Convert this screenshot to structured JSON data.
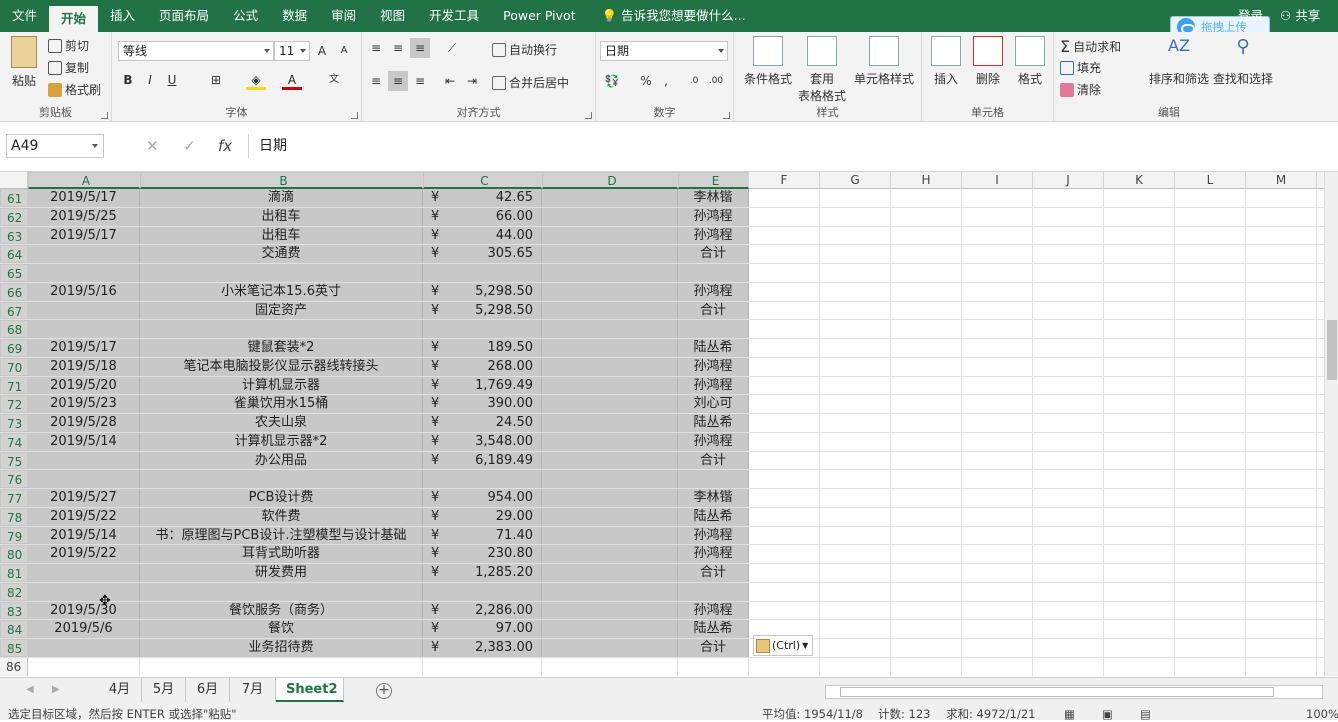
{
  "ribbon_tabs": [
    "文件",
    "开始",
    "插入",
    "页面布局",
    "公式",
    "数据",
    "审阅",
    "视图",
    "开发工具",
    "Power Pivot"
  ],
  "active_tab_index": 1,
  "tell_me": "告诉我您想要做什么...",
  "signin": "登录",
  "share": "共享",
  "baidu_upload": "拖拽上传",
  "clipboard": {
    "paste": "粘贴",
    "cut": "剪切",
    "copy": "复制",
    "format_painter": "格式刷",
    "label": "剪贴板"
  },
  "font": {
    "name": "等线",
    "size": "11",
    "label": "字体",
    "bold": "B",
    "italic": "I",
    "underline": "U"
  },
  "alignment": {
    "wrap": "自动换行",
    "merge": "合并后居中",
    "label": "对齐方式"
  },
  "number": {
    "format": "日期",
    "label": "数字"
  },
  "styles": {
    "cond": "条件格式",
    "table": "套用",
    "table2": "表格格式",
    "cell": "单元格样式",
    "label": "样式"
  },
  "cells": {
    "insert": "插入",
    "delete": "删除",
    "format": "格式",
    "label": "单元格"
  },
  "editing": {
    "autosum": "自动求和",
    "fill": "填充",
    "clear": "清除",
    "sort": "排序和筛选",
    "find": "查找和选择",
    "label": "编辑"
  },
  "namebox": "A49",
  "formula": "日期",
  "columns": [
    "A",
    "B",
    "C",
    "D",
    "E",
    "F",
    "G",
    "H",
    "I",
    "J",
    "K",
    "L",
    "M"
  ],
  "rows": [
    {
      "n": "61",
      "a": "2019/5/17",
      "b": "滴滴",
      "y": "¥",
      "c": "42.65",
      "e": "李林锴"
    },
    {
      "n": "62",
      "a": "2019/5/25",
      "b": "出租车",
      "y": "¥",
      "c": "66.00",
      "e": "孙鸿程"
    },
    {
      "n": "63",
      "a": "2019/5/17",
      "b": "出租车",
      "y": "¥",
      "c": "44.00",
      "e": "孙鸿程"
    },
    {
      "n": "64",
      "a": "",
      "b": "交通费",
      "y": "¥",
      "c": "305.65",
      "e": "合计"
    },
    {
      "n": "65",
      "a": "",
      "b": "",
      "y": "",
      "c": "",
      "e": ""
    },
    {
      "n": "66",
      "a": "2019/5/16",
      "b": "小米笔记本15.6英寸",
      "y": "¥",
      "c": "5,298.50",
      "e": "孙鸿程"
    },
    {
      "n": "67",
      "a": "",
      "b": "固定资产",
      "y": "¥",
      "c": "5,298.50",
      "e": "合计"
    },
    {
      "n": "68",
      "a": "",
      "b": "",
      "y": "",
      "c": "",
      "e": ""
    },
    {
      "n": "69",
      "a": "2019/5/17",
      "b": "键鼠套装*2",
      "y": "¥",
      "c": "189.50",
      "e": "陆丛希"
    },
    {
      "n": "70",
      "a": "2019/5/18",
      "b": "笔记本电脑投影仪显示器线转接头",
      "y": "¥",
      "c": "268.00",
      "e": "孙鸿程"
    },
    {
      "n": "71",
      "a": "2019/5/20",
      "b": "计算机显示器",
      "y": "¥",
      "c": "1,769.49",
      "e": "孙鸿程"
    },
    {
      "n": "72",
      "a": "2019/5/23",
      "b": "雀巢饮用水15桶",
      "y": "¥",
      "c": "390.00",
      "e": "刘心可"
    },
    {
      "n": "73",
      "a": "2019/5/28",
      "b": "农夫山泉",
      "y": "¥",
      "c": "24.50",
      "e": "陆丛希"
    },
    {
      "n": "74",
      "a": "2019/5/14",
      "b": "计算机显示器*2",
      "y": "¥",
      "c": "3,548.00",
      "e": "孙鸿程"
    },
    {
      "n": "75",
      "a": "",
      "b": "办公用品",
      "y": "¥",
      "c": "6,189.49",
      "e": "合计"
    },
    {
      "n": "76",
      "a": "",
      "b": "",
      "y": "",
      "c": "",
      "e": ""
    },
    {
      "n": "77",
      "a": "2019/5/27",
      "b": "PCB设计费",
      "y": "¥",
      "c": "954.00",
      "e": "李林锴"
    },
    {
      "n": "78",
      "a": "2019/5/22",
      "b": "软件费",
      "y": "¥",
      "c": "29.00",
      "e": "陆丛希"
    },
    {
      "n": "79",
      "a": "2019/5/14",
      "b": "书：原理图与PCB设计.注塑模型与设计基础",
      "y": "¥",
      "c": "71.40",
      "e": "孙鸿程"
    },
    {
      "n": "80",
      "a": "2019/5/22",
      "b": "耳背式助听器",
      "y": "¥",
      "c": "230.80",
      "e": "孙鸿程"
    },
    {
      "n": "81",
      "a": "",
      "b": "研发费用",
      "y": "¥",
      "c": "1,285.20",
      "e": "合计"
    },
    {
      "n": "82",
      "a": "",
      "b": "",
      "y": "",
      "c": "",
      "e": ""
    },
    {
      "n": "83",
      "a": "2019/5/30",
      "b": "餐饮服务（商务）",
      "y": "¥",
      "c": "2,286.00",
      "e": "孙鸿程"
    },
    {
      "n": "84",
      "a": "2019/5/6",
      "b": "餐饮",
      "y": "¥",
      "c": "97.00",
      "e": "陆丛希"
    },
    {
      "n": "85",
      "a": "",
      "b": "业务招待费",
      "y": "¥",
      "c": "2,383.00",
      "e": "合计"
    },
    {
      "n": "86",
      "a": "",
      "b": "",
      "y": "",
      "c": "",
      "e": ""
    }
  ],
  "paste_options": "(Ctrl)",
  "sheets": [
    "4月",
    "5月",
    "6月",
    "7月",
    "Sheet2"
  ],
  "active_sheet_index": 4,
  "status": {
    "message": "选定目标区域，然后按 ENTER 或选择\"粘贴\"",
    "average": "平均值: 1954/11/8",
    "count": "计数: 123",
    "sum": "求和: 4972/1/21",
    "zoom": "100%"
  }
}
